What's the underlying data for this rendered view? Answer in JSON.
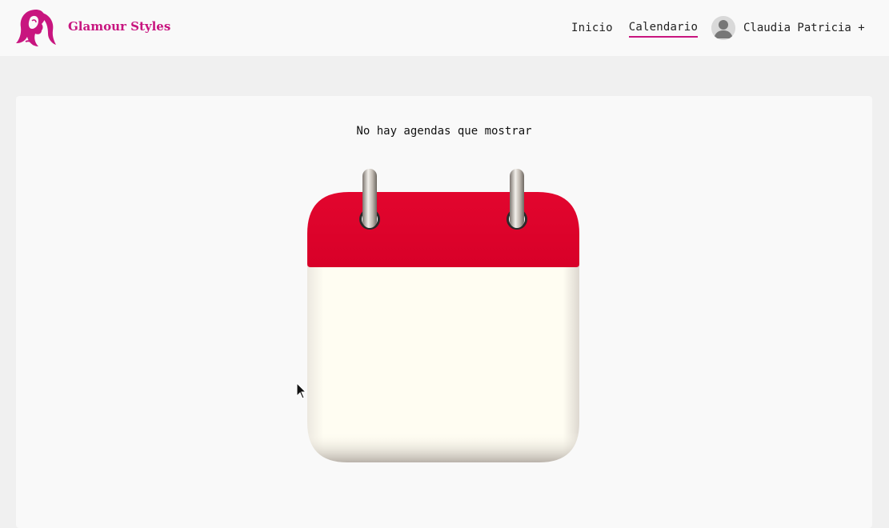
{
  "brand": {
    "name": "Glamour Styles",
    "icon": "woman-profile-logo-icon",
    "color": "#c8157f"
  },
  "nav": {
    "items": [
      {
        "label": "Inicio",
        "active": false
      },
      {
        "label": "Calendario",
        "active": true
      }
    ],
    "accent": "#c8157f"
  },
  "user": {
    "name": "Claudia Patricia +",
    "avatar_icon": "user-avatar-icon"
  },
  "main": {
    "empty_message": "No hay agendas que mostrar",
    "illustration_icon": "calendar-icon",
    "calendar_colors": {
      "header": "#e0002a",
      "page": "#fffdf2"
    }
  }
}
